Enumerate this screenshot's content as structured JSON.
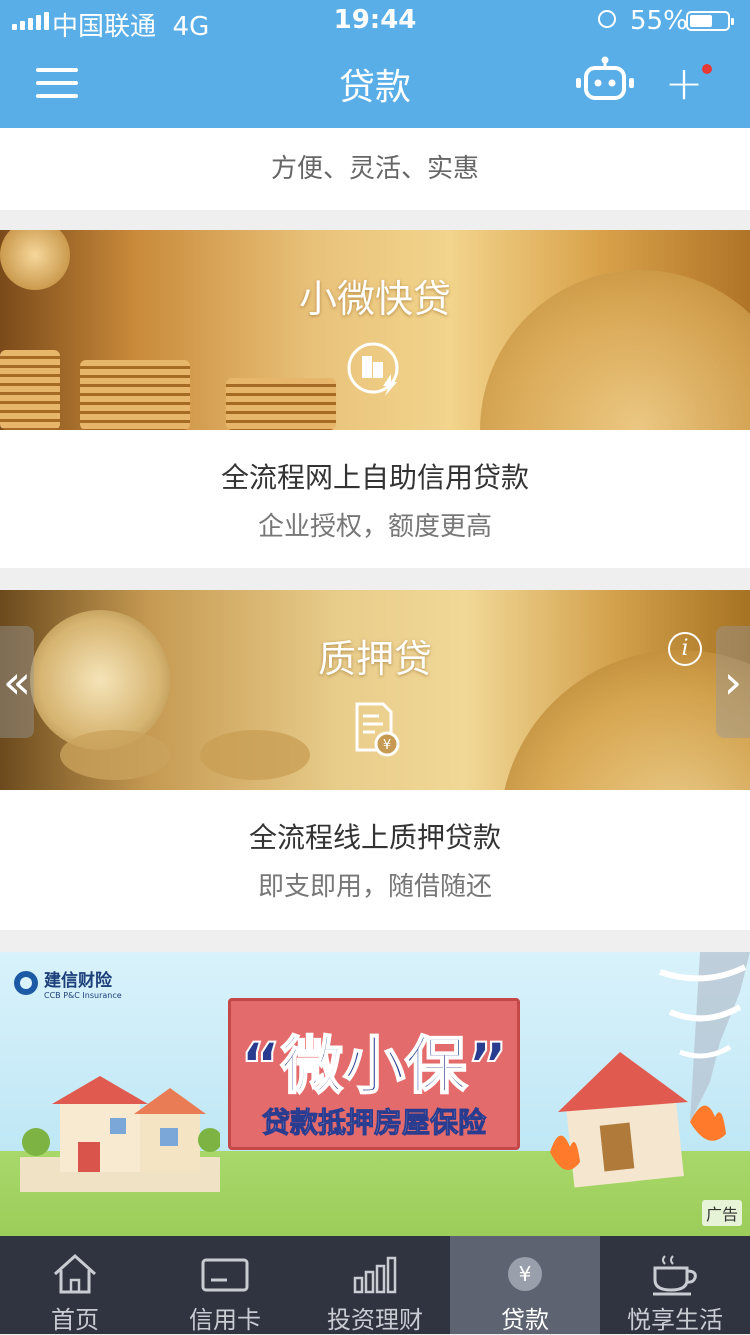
{
  "status_bar": {
    "carrier": "中国联通",
    "network": "4G",
    "time": "19:44",
    "battery_pct": "55%"
  },
  "header": {
    "title": "贷款",
    "menu_icon": "hamburger-icon",
    "robot_icon": "robot-icon",
    "add_icon": "plus-icon"
  },
  "cards": [
    {
      "subtitle": "方便、灵活、实惠"
    },
    {
      "title": "小微快贷",
      "line1": "全流程网上自助信用贷款",
      "line2": "企业授权，额度更高",
      "icon": "building-lightning-icon"
    },
    {
      "title": "质押贷",
      "line1": "全流程线上质押贷款",
      "line2": "即支即用，随借随还",
      "icon": "document-yuan-icon"
    }
  ],
  "carousel": {
    "prev": "«",
    "next": "›",
    "info": "i"
  },
  "ad": {
    "brand_cn": "建信财险",
    "brand_en": "CCB P&C Insurance",
    "headline": "“微小保”",
    "subline": "贷款抵押房屋保险",
    "tag": "广告"
  },
  "tabbar": {
    "active": 3,
    "items": [
      {
        "label": "首页",
        "icon": "home-icon"
      },
      {
        "label": "信用卡",
        "icon": "card-icon"
      },
      {
        "label": "投资理财",
        "icon": "bar-chart-icon"
      },
      {
        "label": "贷款",
        "icon": "yuan-icon"
      },
      {
        "label": "悦享生活",
        "icon": "cup-icon"
      }
    ]
  }
}
